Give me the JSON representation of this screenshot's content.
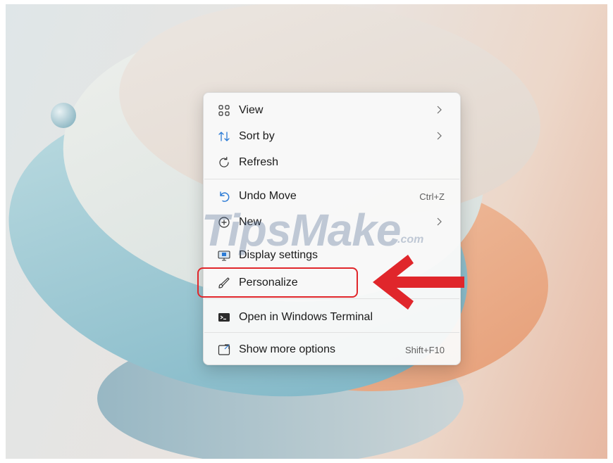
{
  "menu": {
    "items": [
      {
        "label": "View",
        "icon": "view-icon",
        "submenu": true
      },
      {
        "label": "Sort by",
        "icon": "sort-icon",
        "submenu": true
      },
      {
        "label": "Refresh",
        "icon": "refresh-icon"
      },
      {
        "label": "Undo Move",
        "icon": "undo-icon",
        "shortcut": "Ctrl+Z"
      },
      {
        "label": "New",
        "icon": "new-icon",
        "submenu": true
      },
      {
        "label": "Display settings",
        "icon": "display-settings-icon"
      },
      {
        "label": "Personalize",
        "icon": "personalize-icon",
        "highlighted": true
      },
      {
        "label": "Open in Windows Terminal",
        "icon": "terminal-icon"
      },
      {
        "label": "Show more options",
        "icon": "show-more-options-icon",
        "shortcut": "Shift+F10"
      }
    ]
  },
  "annotation": {
    "highlight_color": "#e0262b",
    "arrow_color": "#e0262b",
    "target": "Personalize"
  },
  "watermark": {
    "text": "TipsMake",
    "suffix": ".com"
  },
  "colors": {
    "accent_blue": "#2a7ad5",
    "menu_bg": "#f9f9f9"
  }
}
